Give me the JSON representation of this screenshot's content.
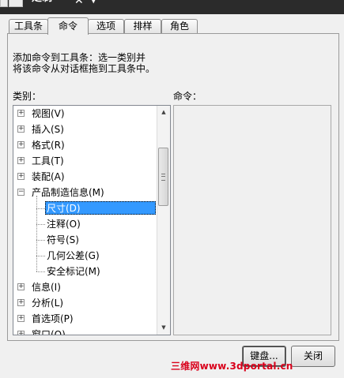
{
  "window": {
    "title": "定制"
  },
  "tabs": [
    {
      "label": "工具条"
    },
    {
      "label": "命令"
    },
    {
      "label": "选项"
    },
    {
      "label": "排样"
    },
    {
      "label": "角色"
    }
  ],
  "active_tab": "命令",
  "description": {
    "line1": "添加命令到工具条：选一类别并",
    "line2": "将该命令从对话框拖到工具条中。"
  },
  "labels": {
    "category": "类别：",
    "commands": "命令："
  },
  "categories": [
    {
      "label": "视图(V)",
      "expander": "+"
    },
    {
      "label": "插入(S)",
      "expander": "+"
    },
    {
      "label": "格式(R)",
      "expander": "+"
    },
    {
      "label": "工具(T)",
      "expander": "+"
    },
    {
      "label": "装配(A)",
      "expander": "+"
    },
    {
      "label": "产品制造信息(M)",
      "expander": "−"
    },
    {
      "label": "尺寸(D)",
      "child": true,
      "selected": true
    },
    {
      "label": "注释(O)",
      "child": true
    },
    {
      "label": "符号(S)",
      "child": true
    },
    {
      "label": "几何公差(G)",
      "child": true
    },
    {
      "label": "安全标记(M)",
      "child": true
    },
    {
      "label": "信息(I)",
      "expander": "+"
    },
    {
      "label": "分析(L)",
      "expander": "+"
    },
    {
      "label": "首选项(P)",
      "expander": "+"
    },
    {
      "label": "窗口(O)",
      "expander": "+"
    }
  ],
  "scrollbar": {
    "up_icon": "▲",
    "down_icon": "▼",
    "position_fraction": 0.2
  },
  "buttons": {
    "keyboard": "键盘...",
    "close": "关闭"
  },
  "watermark": "三维网www.3dportal.cn",
  "colors": {
    "selection": "#3399ff",
    "watermark": "#d9001b",
    "topbar": "#2b2b2b"
  }
}
